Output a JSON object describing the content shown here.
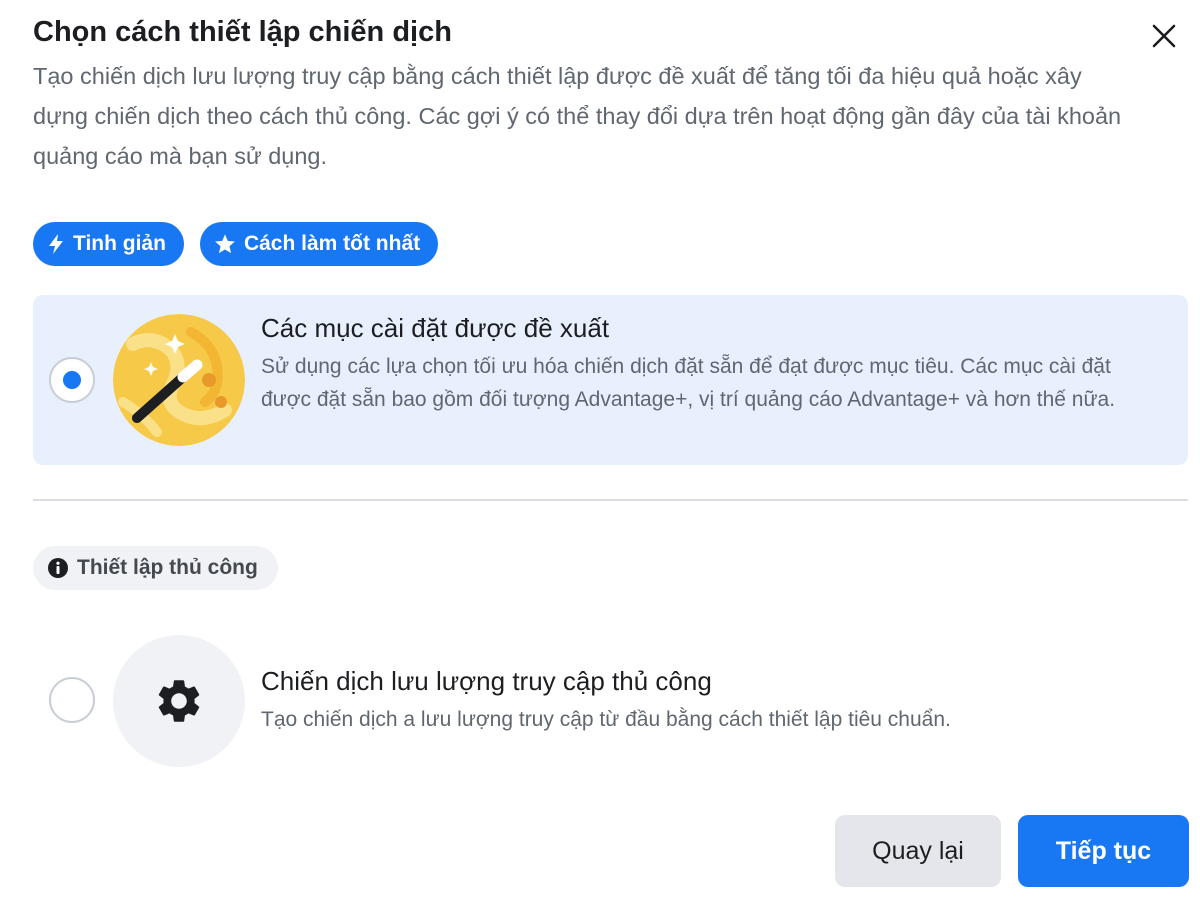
{
  "dialog": {
    "title": "Chọn cách thiết lập chiến dịch",
    "description": "Tạo chiến dịch lưu lượng truy cập bằng cách thiết lập được đề xuất để tăng tối đa hiệu quả hoặc xây dựng chiến dịch theo cách thủ công. Các gợi ý có thể thay đổi dựa trên hoạt động gần đây của tài khoản quảng cáo mà bạn sử dụng.",
    "close_icon": "close-icon"
  },
  "badges": [
    {
      "label": "Tinh giản",
      "icon": "lightning-icon"
    },
    {
      "label": "Cách làm tốt nhất",
      "icon": "star-icon"
    }
  ],
  "options": {
    "recommended": {
      "title": "Các mục cài đặt được đề xuất",
      "description": "Sử dụng các lựa chọn tối ưu hóa chiến dịch đặt sẵn để đạt được mục tiêu. Các mục cài đặt được đặt sẵn bao gồm đối tượng Advantage+, vị trí quảng cáo Advantage+ và hơn thế nữa.",
      "selected": true,
      "icon": "magic-wand-icon"
    },
    "manual_label": "Thiết lập thủ công",
    "manual": {
      "title": "Chiến dịch lưu lượng truy cập thủ công",
      "description": "Tạo chiến dịch a lưu lượng truy cập từ đầu bằng cách thiết lập tiêu chuẩn.",
      "selected": false,
      "icon": "gear-icon"
    }
  },
  "footer": {
    "back_label": "Quay lại",
    "next_label": "Tiếp tục"
  },
  "colors": {
    "accent": "#1877f2",
    "selected_bg": "#e7f0fc",
    "secondary_text": "#606770"
  }
}
